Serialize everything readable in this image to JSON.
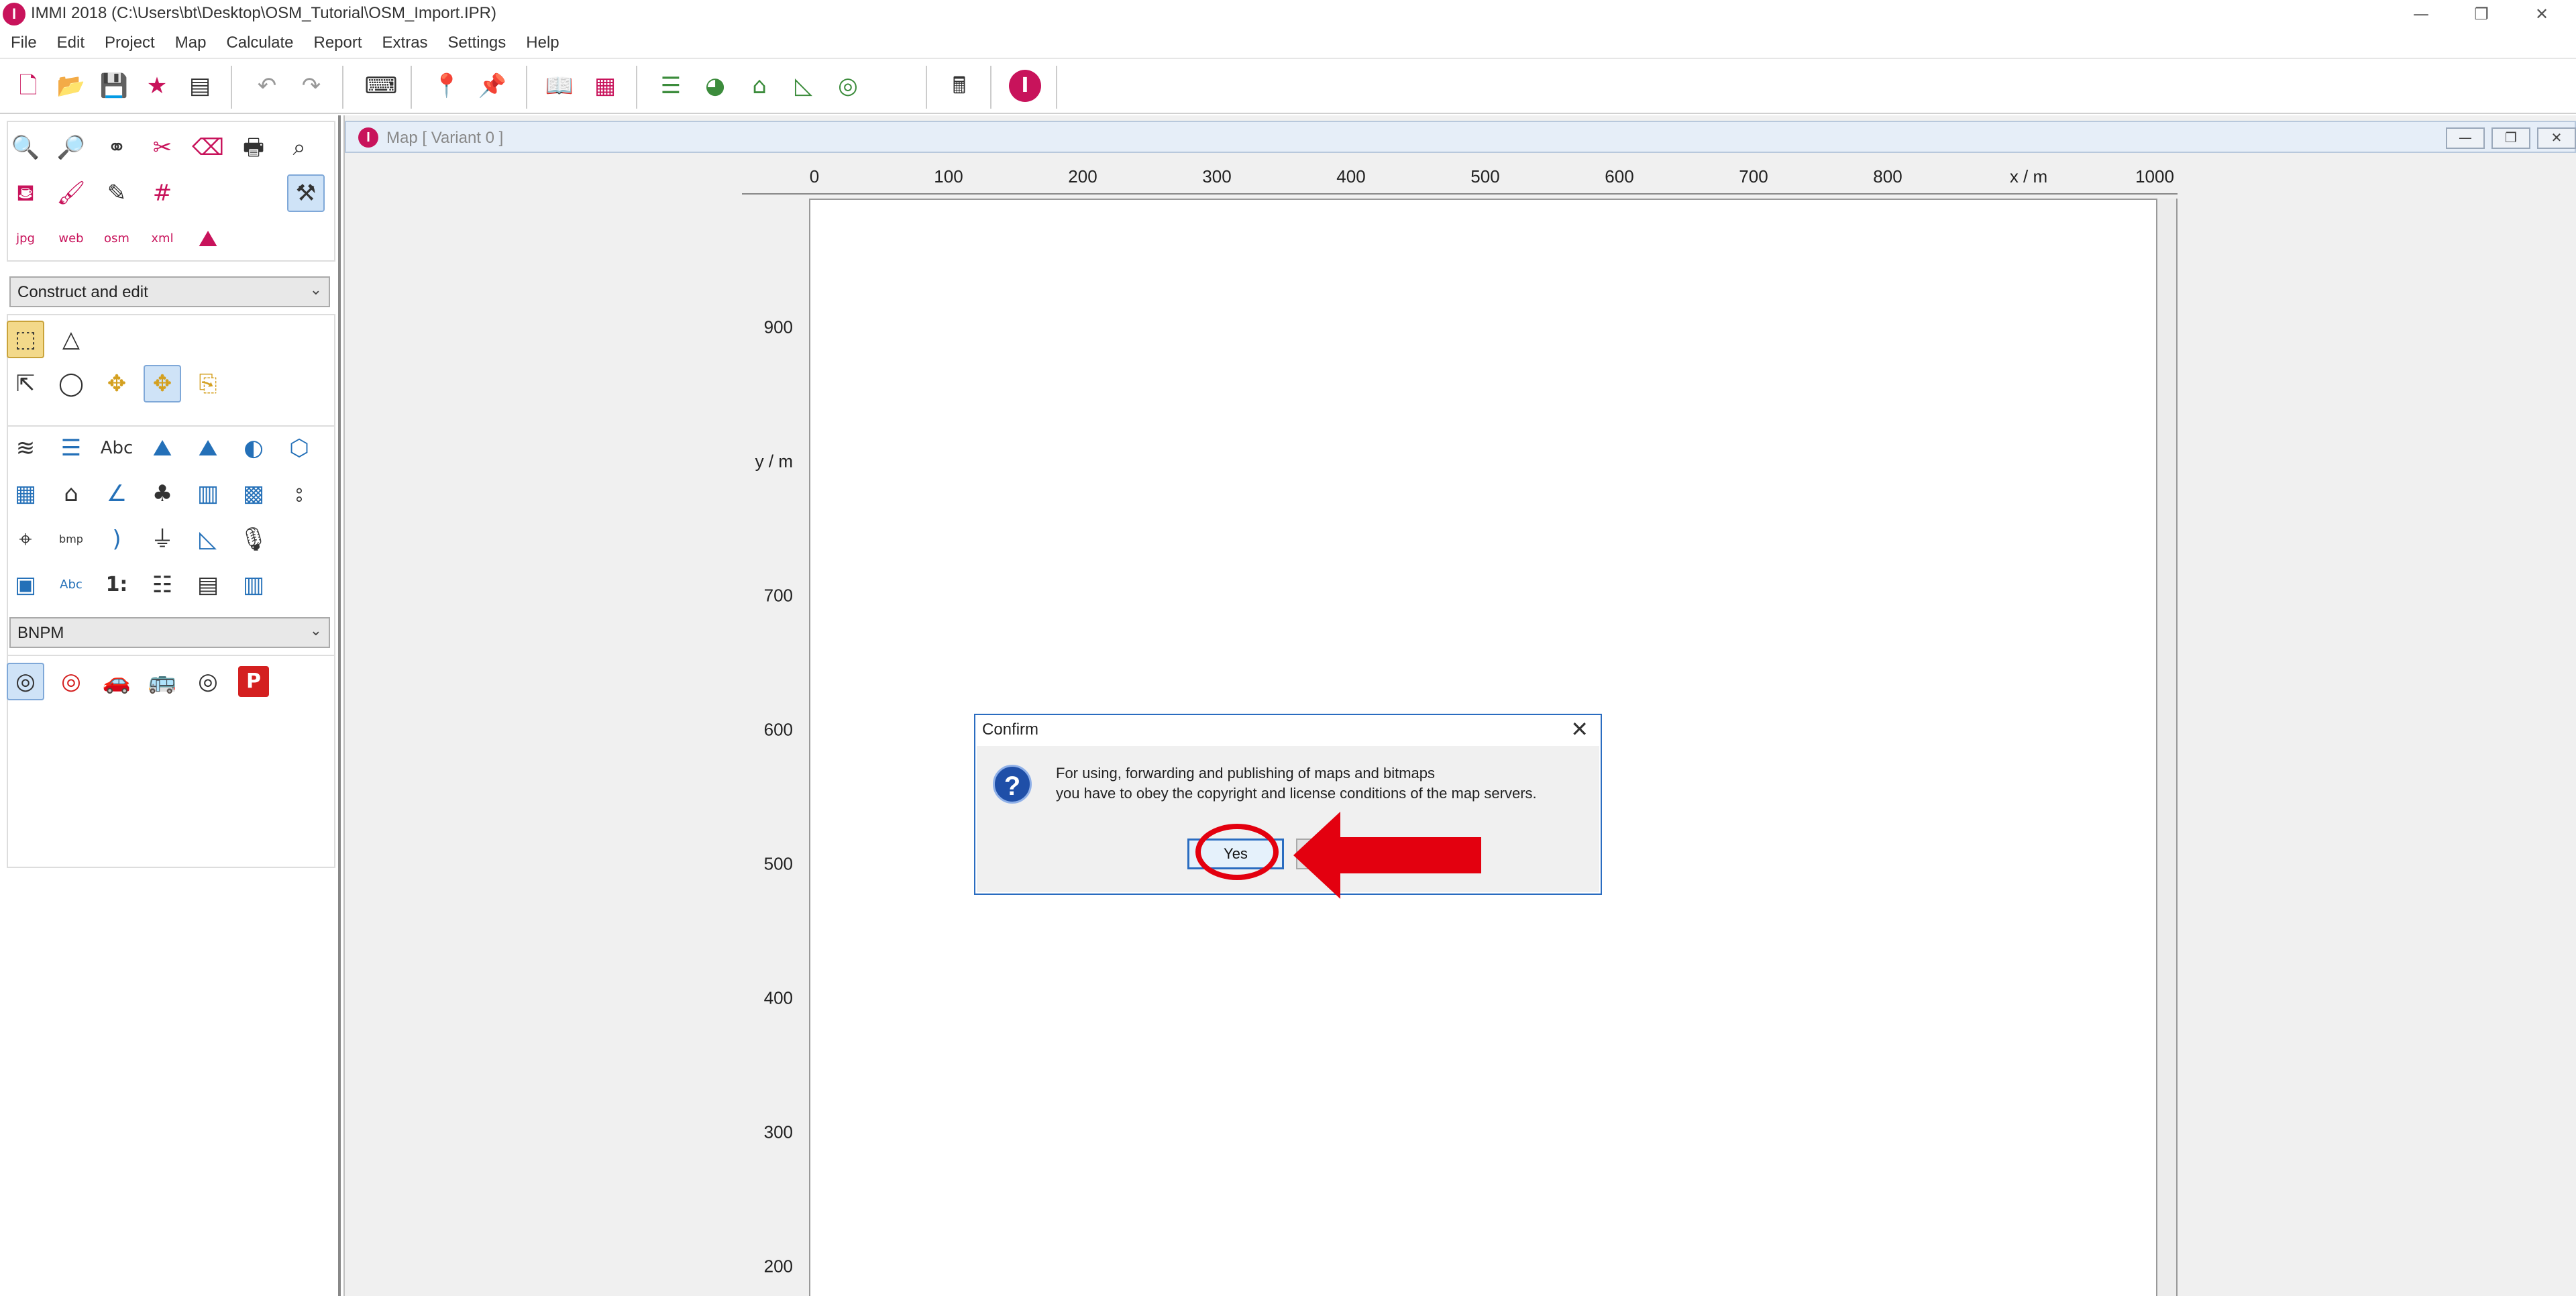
{
  "window": {
    "title": "IMMI 2018 (C:\\Users\\bt\\Desktop\\OSM_Tutorial\\OSM_Import.IPR)",
    "logo_letter": "I",
    "controls": {
      "minimize": "—",
      "restore": "❐",
      "close": "✕"
    }
  },
  "menu": [
    "File",
    "Edit",
    "Project",
    "Map",
    "Calculate",
    "Report",
    "Extras",
    "Settings",
    "Help"
  ],
  "left_panel": {
    "tools_row1": [
      "zoom-in-icon",
      "zoom-out-icon",
      "binoculars-icon",
      "scissors-icon",
      "eraser-icon",
      "printer-icon",
      "zoom-list-icon"
    ],
    "tools_row3_labels": [
      "jpg",
      "web",
      "osm",
      "xml"
    ],
    "mode_select": "Construct and edit",
    "object_select": "BNPM"
  },
  "map_window": {
    "logo_letter": "I",
    "title": "Map  [ Variant 0 ]",
    "controls": {
      "minimize": "—",
      "restore": "❐",
      "close": "✕"
    }
  },
  "map": {
    "x_ticks": [
      "0",
      "100",
      "200",
      "300",
      "400",
      "500",
      "600",
      "700",
      "800",
      "1000"
    ],
    "x_label": "x / m",
    "y_ticks": [
      "900",
      "700",
      "600",
      "500",
      "400",
      "300",
      "200"
    ],
    "y_label": "y / m"
  },
  "dialog": {
    "title": "Confirm",
    "close": "✕",
    "icon": "?",
    "message_line1": "For using, forwarding and publishing of maps and bitmaps",
    "message_line2": "you have to obey the copyright and license conditions of the map servers.",
    "yes_label": "Yes",
    "no_label": ""
  },
  "annotation_color": "#e3000f"
}
